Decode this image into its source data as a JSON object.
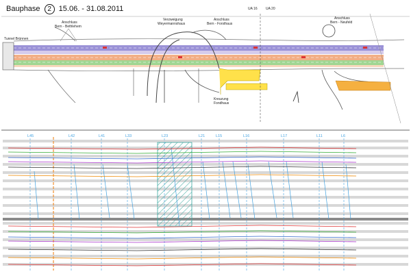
{
  "title": {
    "prefix": "Bauphase",
    "phase": "2",
    "dates": "15.06. - 31.08.2011"
  },
  "plan_labels": [
    {
      "id": "tunnel",
      "text": "Tunnel Brünnen"
    },
    {
      "id": "anschluss-bethlehem-1",
      "text": "Anschluss"
    },
    {
      "id": "anschluss-bethlehem-2",
      "text": "Bern - Bethlehem"
    },
    {
      "id": "verzweigung-1",
      "text": "Verzweigung"
    },
    {
      "id": "verzweigung-2",
      "text": "Weyermannshaus"
    },
    {
      "id": "anschluss-forsthaus-1",
      "text": "Anschluss"
    },
    {
      "id": "anschluss-forsthaus-2",
      "text": "Bern - Forsthaus"
    },
    {
      "id": "ua16",
      "text": "UA 16"
    },
    {
      "id": "ua20",
      "text": "UA 20"
    },
    {
      "id": "anschluss-neufeld-1",
      "text": "Anschluss"
    },
    {
      "id": "anschluss-neufeld-2",
      "text": "Bern - Neufeld"
    },
    {
      "id": "kreuzung-1",
      "text": "Kreuzung"
    },
    {
      "id": "kreuzung-2",
      "text": "Fondhaus"
    }
  ],
  "section_labels": [
    "L45",
    "L42",
    "L41",
    "L33",
    "L23",
    "L21",
    "L15",
    "L16",
    "L17",
    "L11",
    "L6"
  ],
  "colors": {
    "lane_purple": "#8a7fd0",
    "lane_orange": "#f0a070",
    "lane_green": "#8fcf7f",
    "highlight_yellow": "#ffe14a",
    "highlight_orange": "#f5b040",
    "accent_blue": "#3fa0e0",
    "hatch_teal": "#3aa8a0",
    "grid_gray": "#c8c8c8"
  }
}
